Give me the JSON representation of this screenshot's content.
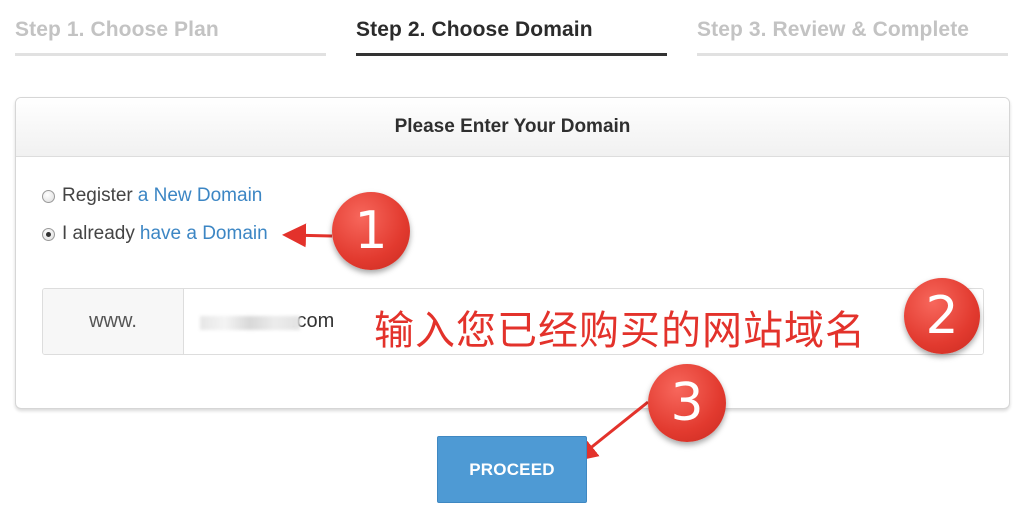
{
  "steps": [
    {
      "label": "Step 1. Choose Plan"
    },
    {
      "label": "Step 2. Choose Domain"
    },
    {
      "label": "Step 3. Review & Complete"
    }
  ],
  "panel": {
    "title": "Please Enter Your Domain",
    "options": [
      {
        "prefix": "Register",
        "link": "a New Domain",
        "selected": false
      },
      {
        "prefix": "I already",
        "link": "have a Domain",
        "selected": true
      }
    ],
    "domain": {
      "prefix": "www.",
      "value": "                .com"
    }
  },
  "annotation": {
    "note": "输入您已经购买的网站域名",
    "markers": [
      "1",
      "2",
      "3"
    ],
    "color": "#e3322b"
  },
  "proceed_label": "PROCEED",
  "colors": {
    "accent": "#4e9ad4",
    "link": "#3c86c4"
  }
}
